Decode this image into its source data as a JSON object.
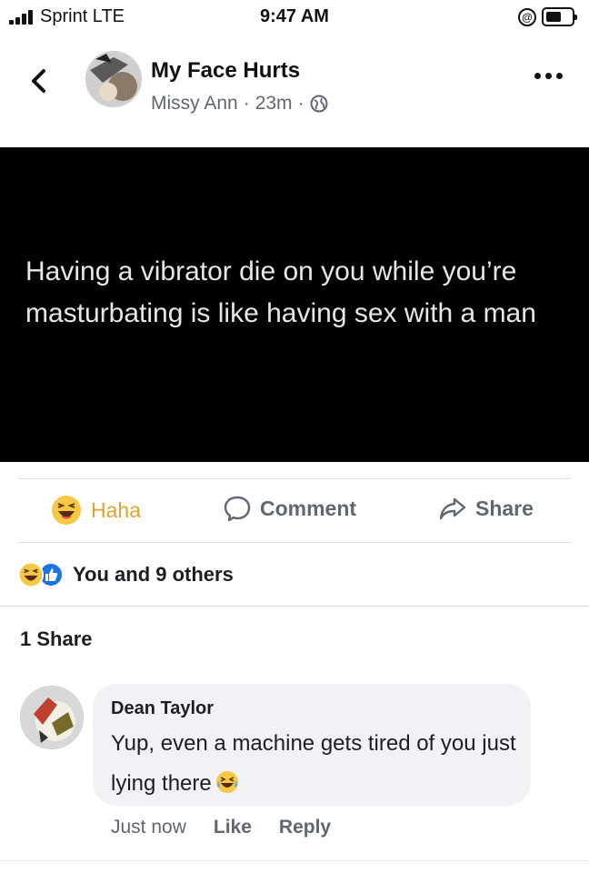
{
  "status_bar": {
    "carrier": "Sprint  LTE",
    "time": "9:47 AM",
    "signal_icon": "signal-bars-icon",
    "orientation_lock_icon": "orientation-lock-icon",
    "battery_icon": "battery-icon"
  },
  "header": {
    "page_name": "My Face Hurts",
    "author": "Missy Ann",
    "separator": "·",
    "time_ago": "23m",
    "privacy_icon": "globe-icon",
    "back_icon": "chevron-left-icon",
    "more_icon": "more-dots-icon"
  },
  "post": {
    "text": "Having a vibrator die on you while you’re masturbating is like having sex with a man",
    "background": "#000000"
  },
  "actions": {
    "haha_label": "Haha",
    "comment_label": "Comment",
    "share_label": "Share",
    "haha_color": "#e1a32b"
  },
  "reactions": {
    "summary": "You and 9 others"
  },
  "shares": {
    "count_label": "1 Share"
  },
  "comment": {
    "author": "Dean Taylor",
    "text": "Yup, even a machine gets tired of you just lying there",
    "emoji_icon": "laughing-tears-emoji",
    "time": "Just now",
    "like_label": "Like",
    "reply_label": "Reply"
  },
  "colors": {
    "accent_blue": "#1b74e4",
    "secondary_text": "#606770",
    "bubble_bg": "#f0f2f5"
  }
}
